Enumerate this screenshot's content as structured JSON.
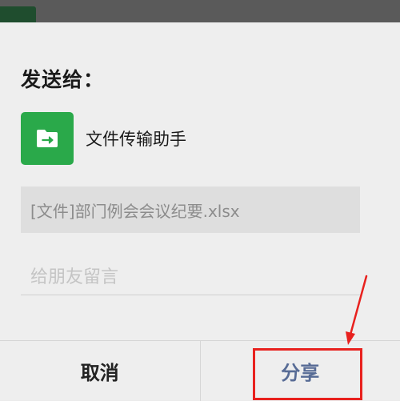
{
  "dialog": {
    "title": "发送给：",
    "recipient": {
      "name": "文件传输助手",
      "avatar_icon": "folder-share-icon",
      "avatar_color": "#2aa94a"
    },
    "file_label": "[文件]部门例会会议纪要.xlsx",
    "message": {
      "placeholder": "给朋友留言",
      "value": ""
    },
    "buttons": {
      "cancel": "取消",
      "share": "分享"
    }
  },
  "colors": {
    "share_text": "#576b95",
    "annotation": "#e8211e"
  },
  "annotation": {
    "target": "share-button",
    "icon": "red-arrow-icon"
  }
}
